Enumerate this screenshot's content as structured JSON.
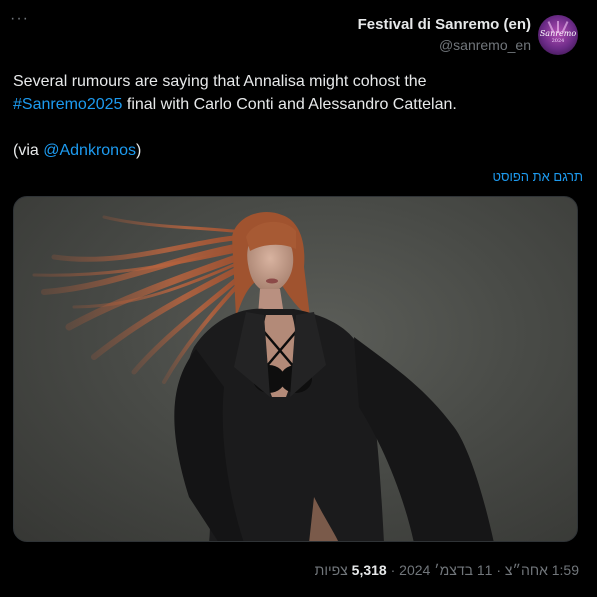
{
  "tweet": {
    "more_icon": "more-horizontal-icon",
    "author": {
      "display_name": "Festival di Sanremo (en)",
      "handle": "@sanremo_en",
      "avatar_logo_text": "Sanremo",
      "avatar_logo_year": "2024"
    },
    "text": {
      "line1": "Several rumours are saying that Annalisa might cohost the",
      "hashtag": "#Sanremo2025",
      "line2_rest": " final with Carlo Conti and Alessandro Cattelan.",
      "via_prefix": "(via ",
      "mention": "@Adnkronos",
      "via_suffix": ")"
    },
    "translate_label": "תרגם את הפוסט",
    "meta": {
      "time": "1:59 אחה״צ",
      "separator": "·",
      "date": "11 בדצמ׳ 2024",
      "views_count": "5,318",
      "views_label": "צפיות"
    },
    "colors": {
      "background": "#000000",
      "text": "#e7e9ea",
      "secondary": "#71767b",
      "link": "#1d9bf0"
    }
  }
}
